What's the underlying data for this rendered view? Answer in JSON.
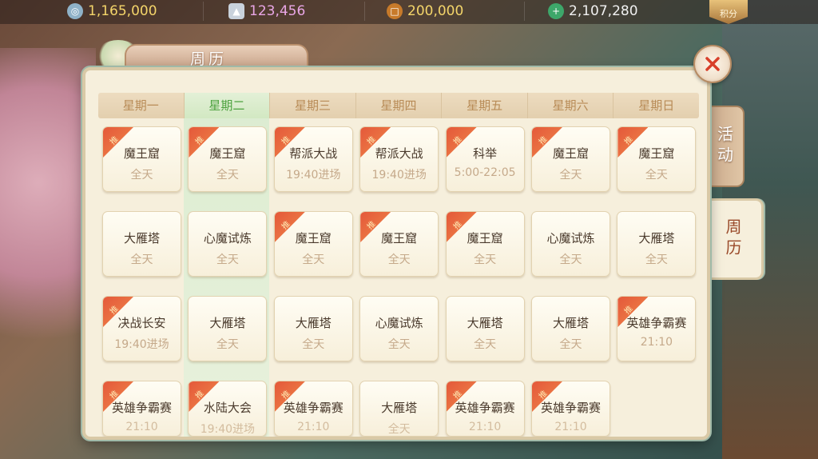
{
  "resources": [
    {
      "icon": "silver-coin-icon",
      "value": "1,165,000"
    },
    {
      "icon": "silver-ingot-icon",
      "value": "123,456"
    },
    {
      "icon": "copper-coin-icon",
      "value": "200,000"
    },
    {
      "icon": "jade-coin-icon",
      "value": "2,107,280"
    }
  ],
  "score_badge": "积分",
  "panel": {
    "title": "周历"
  },
  "side_tabs": {
    "activity": "活动",
    "calendar": "周历"
  },
  "badge_label": "推",
  "days": [
    "星期一",
    "星期二",
    "星期三",
    "星期四",
    "星期五",
    "星期六",
    "星期日"
  ],
  "active_day_index": 1,
  "rows": [
    [
      {
        "name": "魔王窟",
        "time": "全天",
        "badge": true
      },
      {
        "name": "魔王窟",
        "time": "全天",
        "badge": true
      },
      {
        "name": "帮派大战",
        "time": "19:40进场",
        "badge": true
      },
      {
        "name": "帮派大战",
        "time": "19:40进场",
        "badge": true
      },
      {
        "name": "科举",
        "time": "5:00-22:05",
        "badge": true
      },
      {
        "name": "魔王窟",
        "time": "全天",
        "badge": true
      },
      {
        "name": "魔王窟",
        "time": "全天",
        "badge": true
      }
    ],
    [
      {
        "name": "大雁塔",
        "time": "全天",
        "badge": false
      },
      {
        "name": "心魔试炼",
        "time": "全天",
        "badge": false
      },
      {
        "name": "魔王窟",
        "time": "全天",
        "badge": true
      },
      {
        "name": "魔王窟",
        "time": "全天",
        "badge": true
      },
      {
        "name": "魔王窟",
        "time": "全天",
        "badge": true
      },
      {
        "name": "心魔试炼",
        "time": "全天",
        "badge": false
      },
      {
        "name": "大雁塔",
        "time": "全天",
        "badge": false
      }
    ],
    [
      {
        "name": "决战长安",
        "time": "19:40进场",
        "badge": true
      },
      {
        "name": "大雁塔",
        "time": "全天",
        "badge": false
      },
      {
        "name": "大雁塔",
        "time": "全天",
        "badge": false
      },
      {
        "name": "心魔试炼",
        "time": "全天",
        "badge": false
      },
      {
        "name": "大雁塔",
        "time": "全天",
        "badge": false
      },
      {
        "name": "大雁塔",
        "time": "全天",
        "badge": false
      },
      {
        "name": "英雄争霸赛",
        "time": "21:10",
        "badge": true
      }
    ],
    [
      {
        "name": "英雄争霸赛",
        "time": "21:10",
        "badge": true
      },
      {
        "name": "水陆大会",
        "time": "19:40进场",
        "badge": true
      },
      {
        "name": "英雄争霸赛",
        "time": "21:10",
        "badge": true
      },
      {
        "name": "大雁塔",
        "time": "全天",
        "badge": false
      },
      {
        "name": "英雄争霸赛",
        "time": "21:10",
        "badge": true
      },
      {
        "name": "英雄争霸赛",
        "time": "21:10",
        "badge": true
      }
    ]
  ]
}
